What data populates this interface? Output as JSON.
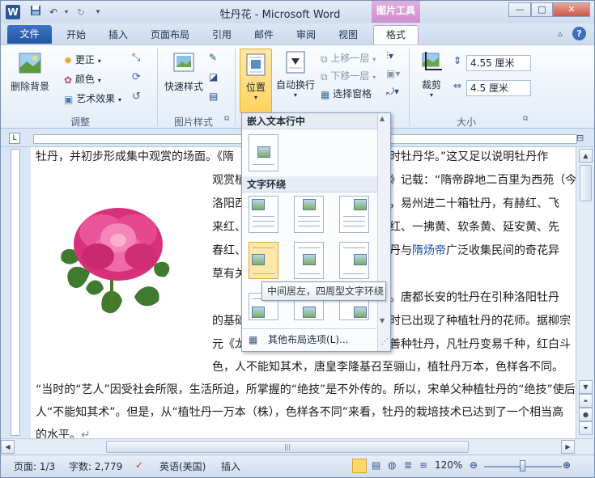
{
  "window": {
    "title": "牡丹花 - Microsoft Word",
    "context_tab_group": "图片工具"
  },
  "qat": {
    "word_icon": "W"
  },
  "tabs": [
    {
      "label": "文件"
    },
    {
      "label": "开始"
    },
    {
      "label": "插入"
    },
    {
      "label": "页面布局"
    },
    {
      "label": "引用"
    },
    {
      "label": "邮件"
    },
    {
      "label": "审阅"
    },
    {
      "label": "视图"
    },
    {
      "label": "格式"
    }
  ],
  "ribbon": {
    "adjust": {
      "remove_bg": "删除背景",
      "corrections": "更正",
      "color": "颜色",
      "artistic": "艺术效果",
      "label": "调整"
    },
    "styles": {
      "quick_styles": "快速样式",
      "label": "图片样式"
    },
    "arrange": {
      "position": "位置",
      "wrap": "自动换行",
      "bring_forward": "上移一层",
      "send_backward": "下移一层",
      "selection_pane": "选择窗格"
    },
    "size": {
      "crop": "裁剪",
      "height": "4.55 厘米",
      "width": "4.5 厘米",
      "label": "大小"
    }
  },
  "document": {
    "lines": [
      "牡丹，并初步形成集中观赏的场面。《隋",
      "观赏植",
      "洛阳西",
      "来红、",
      "春红、",
      "草有关",
      "的基础",
      "元《龙",
      "色，人不能知其术，唐皇李隆基召至骊山，植牡丹万本，色样各不同。",
      "“当时的“艺人”因受社会所限，生活所迫，所掌握的“绝技”是不外传的。所以，宋单父种植牡丹的“绝技”使后",
      "人“不能知其术”。但是，从“植牡丹一万本（株），色样各不同”来看，牡丹的栽培技术已达到了一个相当高",
      "的水平。"
    ],
    "right_fragments": [
      "时牡丹华。”这又足以说明牡丹作",
      "》记载：“隋帝辟地二百里为西苑（今",
      "，易州进二十箱牡丹，有赫红、飞",
      "红、一拂黄、软条黄、延安黄、先",
      "丹与",
      "隋炀帝",
      "广泛收集民间的奇花异",
      "。唐都长安的牡丹在引种洛阳牡丹",
      "时已出现了种植牡丹的花师。据柳宗",
      "善种牡丹，凡牡丹变易千种，红白斗"
    ],
    "pilcrow": "↵"
  },
  "dropdown": {
    "inline_header": "嵌入文本行中",
    "wrap_header": "文字环绕",
    "more_options": "其他布局选项(L)...",
    "tooltip": "中间居左，四周型文字环绕"
  },
  "status": {
    "page": "页面: 1/3",
    "words": "字数: 2,779",
    "language": "英语(美国)",
    "mode": "插入",
    "zoom": "120%"
  }
}
